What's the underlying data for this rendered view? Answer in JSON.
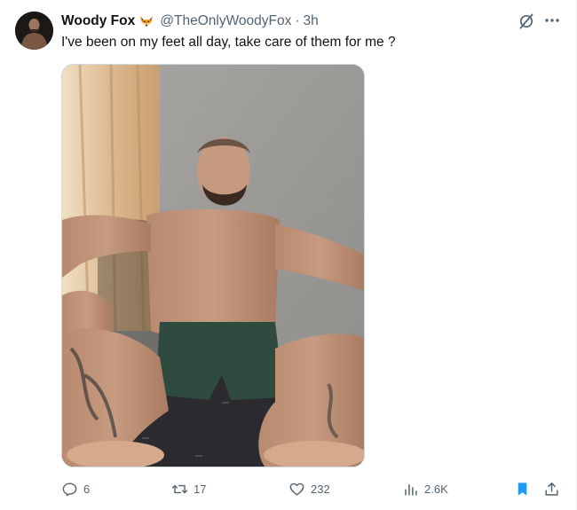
{
  "author": {
    "display_name": "Woody Fox",
    "emoji_icon": "fox-face-emoji",
    "handle": "@TheOnlyWoodyFox",
    "separator": "·",
    "time": "3h"
  },
  "tweet": {
    "text": "I've been on my feet all day, take care of them for me ?"
  },
  "header_icons": [
    "grok-icon",
    "more-icon"
  ],
  "actions": {
    "replies": "6",
    "reposts": "17",
    "likes": "232",
    "views": "2.6K"
  },
  "colors": {
    "text_primary": "#0f1419",
    "text_secondary": "#536471",
    "bookmark_active": "#1d9bf0",
    "border": "#cfd9de"
  }
}
